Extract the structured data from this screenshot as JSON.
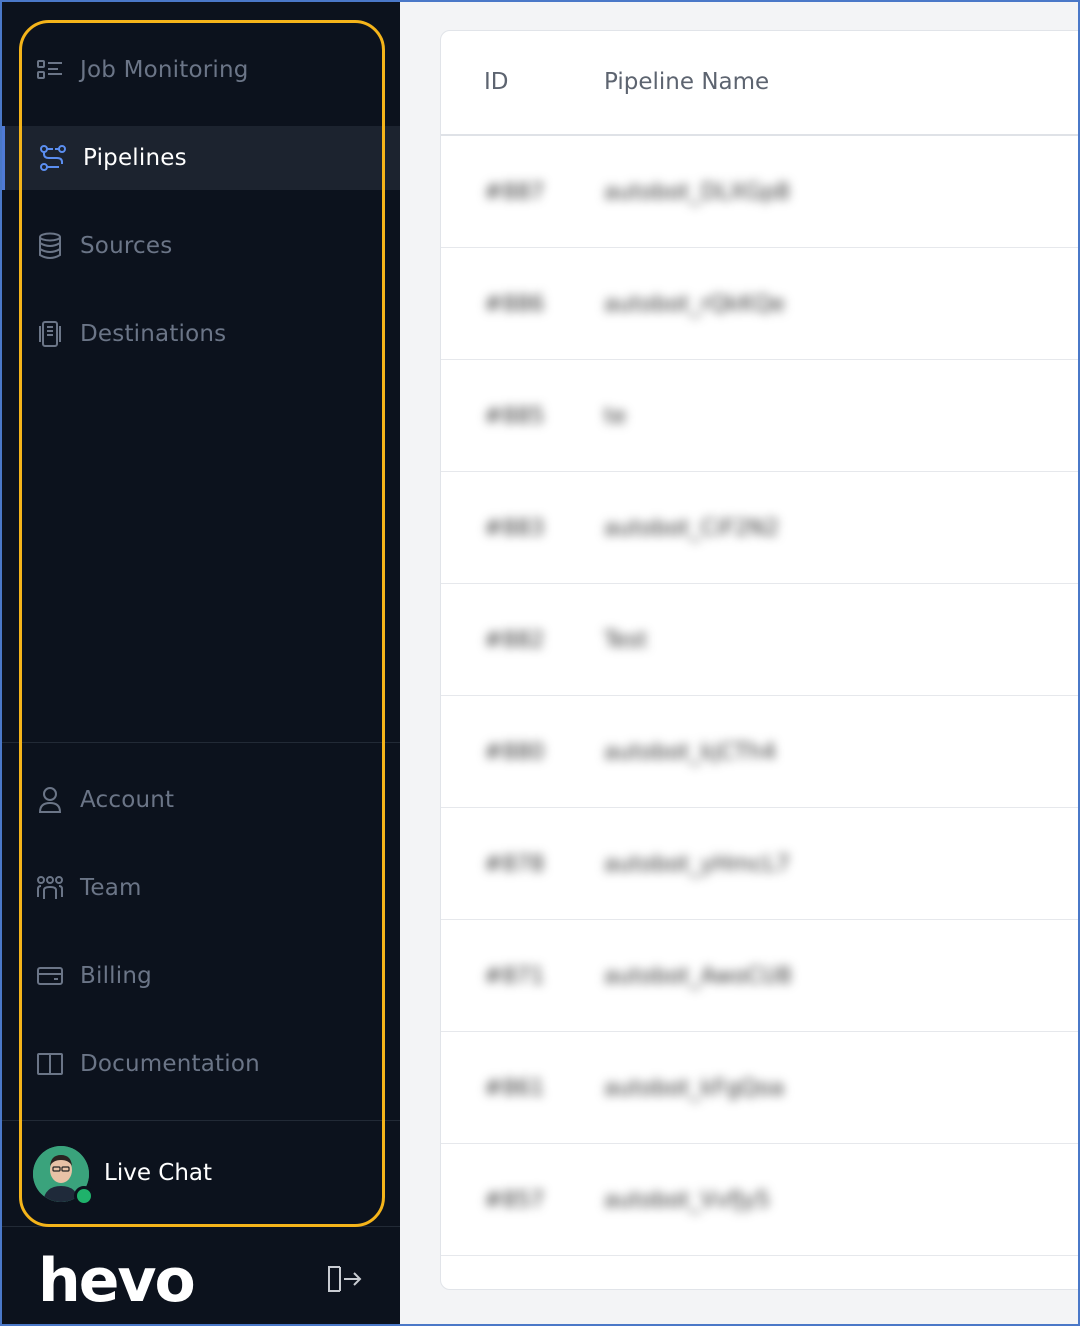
{
  "sidebar": {
    "nav_top": [
      {
        "label": "Job Monitoring",
        "icon": "list-icon",
        "active": false
      },
      {
        "label": "Pipelines",
        "icon": "pipeline-icon",
        "active": true
      },
      {
        "label": "Sources",
        "icon": "database-icon",
        "active": false
      },
      {
        "label": "Destinations",
        "icon": "destination-icon",
        "active": false
      }
    ],
    "nav_bottom": [
      {
        "label": "Account",
        "icon": "user-icon"
      },
      {
        "label": "Team",
        "icon": "team-icon"
      },
      {
        "label": "Billing",
        "icon": "card-icon"
      },
      {
        "label": "Documentation",
        "icon": "book-icon"
      }
    ],
    "live_chat": {
      "label": "Live Chat",
      "status": "online"
    },
    "logo_text": "hevo"
  },
  "table": {
    "headers": {
      "id": "ID",
      "name": "Pipeline Name"
    },
    "rows": [
      {
        "id": "#887",
        "name": "autobot_DLXGp8"
      },
      {
        "id": "#886",
        "name": "autobot_rQkKQe"
      },
      {
        "id": "#885",
        "name": "te"
      },
      {
        "id": "#883",
        "name": "autobot_CiF2N2"
      },
      {
        "id": "#882",
        "name": "Test"
      },
      {
        "id": "#880",
        "name": "autobot_kjCTh4"
      },
      {
        "id": "#878",
        "name": "autobot_yHmcL7"
      },
      {
        "id": "#871",
        "name": "autobot_AwoCU8"
      },
      {
        "id": "#861",
        "name": "autobot_kFgQoa"
      },
      {
        "id": "#857",
        "name": "autobot_VvfJy5"
      }
    ]
  },
  "colors": {
    "accent": "#4f7ad6",
    "highlight": "#f5b41a",
    "sidebar_bg": "#0c121d"
  }
}
